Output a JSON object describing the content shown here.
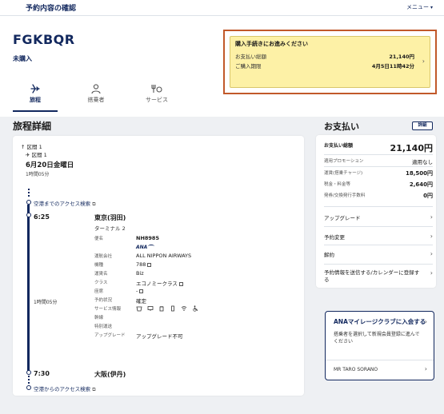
{
  "topbar": {
    "title": "予約内容の確認",
    "menu_label": "メニュー",
    "menu_icon": "chevron-down-icon"
  },
  "booking": {
    "code": "FGKBQR",
    "status": "未購入"
  },
  "notice": {
    "title": "購入手続きにお進みください",
    "rows": [
      {
        "label": "お支払い総額",
        "value": "21,140円"
      },
      {
        "label": "ご購入期限",
        "value": "4月5日11時42分"
      }
    ]
  },
  "tabs": [
    {
      "label": "旅程",
      "icon": "plane-icon",
      "active": true
    },
    {
      "label": "搭乗者",
      "icon": "person-icon",
      "active": false
    },
    {
      "label": "サービス",
      "icon": "service-icon",
      "active": false
    }
  ],
  "itinerary": {
    "title": "旅程詳細",
    "segment_label": "区間 1",
    "subsegment_label": "区間 1",
    "date": "6月20日金曜日",
    "duration": "1時間05分",
    "access_before": "空港までのアクセス検索",
    "access_after": "空港からのアクセス検索",
    "departure": {
      "time": "6:25",
      "airport": "東京(羽田)",
      "terminal": "ターミナル 2"
    },
    "arrival": {
      "time": "7:30",
      "airport": "大阪(伊丹)"
    },
    "total_time": "1時間05分",
    "details": [
      {
        "key": "便名",
        "value": "NH8985"
      },
      {
        "key": "",
        "value": "ANA"
      },
      {
        "key": "運航会社",
        "value": "ALL NIPPON AIRWAYS"
      },
      {
        "key": "機種",
        "value": "788"
      },
      {
        "key": "運賃名",
        "value": "Biz"
      },
      {
        "key": "クラス",
        "value": "エコノミークラス"
      },
      {
        "key": "座席",
        "value": "-"
      },
      {
        "key": "予約状況",
        "value": "確定"
      },
      {
        "key": "サービス情報",
        "value": ""
      },
      {
        "key": "幹線",
        "value": ""
      },
      {
        "key": "特別運送",
        "value": ""
      },
      {
        "key": "アップグレード",
        "value": "アップグレード不可"
      }
    ]
  },
  "payment": {
    "title": "お支払い",
    "detail_button": "詳細",
    "rows": [
      {
        "label": "お支払い総額",
        "value": "21,140円"
      },
      {
        "label": "適用プロモーション",
        "value": "適用なし"
      },
      {
        "label": "運賃(搭乗チャージ)",
        "value": "18,500円"
      },
      {
        "label": "税金・料金等",
        "value": "2,640円"
      },
      {
        "label": "発券/交換発行手数料",
        "value": "0円"
      }
    ]
  },
  "links": [
    {
      "label": "アップグレード"
    },
    {
      "label": "予約変更"
    },
    {
      "label": "解約"
    },
    {
      "label": "予約情報を送信する/カレンダーに登録する"
    }
  ],
  "club": {
    "title": "ANAマイレージクラブに入会する",
    "description": "搭乗者を選択して新規会員登録に進んでください",
    "member": "MR TARO SORANO"
  },
  "colors": {
    "brand": "#12285e",
    "notice_bg": "#fdf1a6",
    "highlight_border": "#c1592a"
  }
}
